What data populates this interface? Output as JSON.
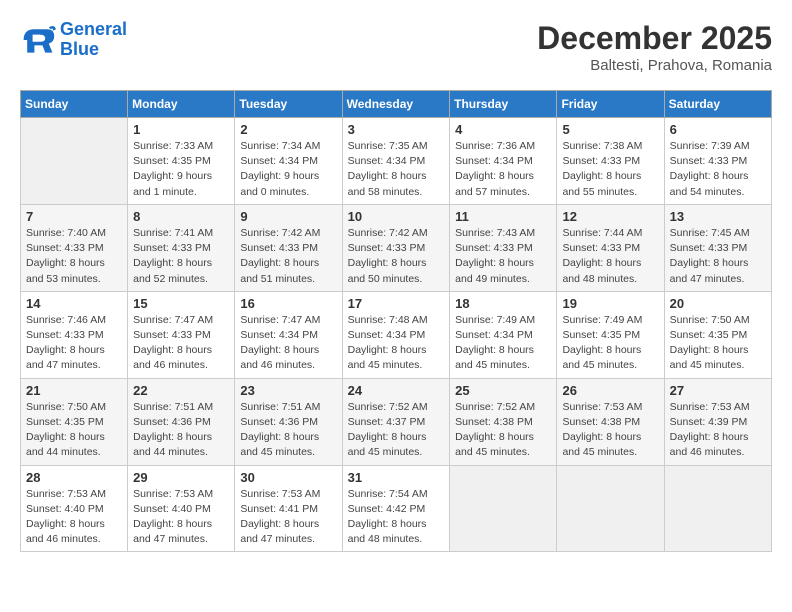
{
  "header": {
    "logo_general": "General",
    "logo_blue": "Blue",
    "month_year": "December 2025",
    "location": "Baltesti, Prahova, Romania"
  },
  "days_of_week": [
    "Sunday",
    "Monday",
    "Tuesday",
    "Wednesday",
    "Thursday",
    "Friday",
    "Saturday"
  ],
  "weeks": [
    [
      {
        "day": "",
        "empty": true
      },
      {
        "day": "1",
        "sunrise": "7:33 AM",
        "sunset": "4:35 PM",
        "daylight": "9 hours and 1 minute."
      },
      {
        "day": "2",
        "sunrise": "7:34 AM",
        "sunset": "4:34 PM",
        "daylight": "9 hours and 0 minutes."
      },
      {
        "day": "3",
        "sunrise": "7:35 AM",
        "sunset": "4:34 PM",
        "daylight": "8 hours and 58 minutes."
      },
      {
        "day": "4",
        "sunrise": "7:36 AM",
        "sunset": "4:34 PM",
        "daylight": "8 hours and 57 minutes."
      },
      {
        "day": "5",
        "sunrise": "7:38 AM",
        "sunset": "4:33 PM",
        "daylight": "8 hours and 55 minutes."
      },
      {
        "day": "6",
        "sunrise": "7:39 AM",
        "sunset": "4:33 PM",
        "daylight": "8 hours and 54 minutes."
      }
    ],
    [
      {
        "day": "7",
        "sunrise": "7:40 AM",
        "sunset": "4:33 PM",
        "daylight": "8 hours and 53 minutes."
      },
      {
        "day": "8",
        "sunrise": "7:41 AM",
        "sunset": "4:33 PM",
        "daylight": "8 hours and 52 minutes."
      },
      {
        "day": "9",
        "sunrise": "7:42 AM",
        "sunset": "4:33 PM",
        "daylight": "8 hours and 51 minutes."
      },
      {
        "day": "10",
        "sunrise": "7:42 AM",
        "sunset": "4:33 PM",
        "daylight": "8 hours and 50 minutes."
      },
      {
        "day": "11",
        "sunrise": "7:43 AM",
        "sunset": "4:33 PM",
        "daylight": "8 hours and 49 minutes."
      },
      {
        "day": "12",
        "sunrise": "7:44 AM",
        "sunset": "4:33 PM",
        "daylight": "8 hours and 48 minutes."
      },
      {
        "day": "13",
        "sunrise": "7:45 AM",
        "sunset": "4:33 PM",
        "daylight": "8 hours and 47 minutes."
      }
    ],
    [
      {
        "day": "14",
        "sunrise": "7:46 AM",
        "sunset": "4:33 PM",
        "daylight": "8 hours and 47 minutes."
      },
      {
        "day": "15",
        "sunrise": "7:47 AM",
        "sunset": "4:33 PM",
        "daylight": "8 hours and 46 minutes."
      },
      {
        "day": "16",
        "sunrise": "7:47 AM",
        "sunset": "4:34 PM",
        "daylight": "8 hours and 46 minutes."
      },
      {
        "day": "17",
        "sunrise": "7:48 AM",
        "sunset": "4:34 PM",
        "daylight": "8 hours and 45 minutes."
      },
      {
        "day": "18",
        "sunrise": "7:49 AM",
        "sunset": "4:34 PM",
        "daylight": "8 hours and 45 minutes."
      },
      {
        "day": "19",
        "sunrise": "7:49 AM",
        "sunset": "4:35 PM",
        "daylight": "8 hours and 45 minutes."
      },
      {
        "day": "20",
        "sunrise": "7:50 AM",
        "sunset": "4:35 PM",
        "daylight": "8 hours and 45 minutes."
      }
    ],
    [
      {
        "day": "21",
        "sunrise": "7:50 AM",
        "sunset": "4:35 PM",
        "daylight": "8 hours and 44 minutes."
      },
      {
        "day": "22",
        "sunrise": "7:51 AM",
        "sunset": "4:36 PM",
        "daylight": "8 hours and 44 minutes."
      },
      {
        "day": "23",
        "sunrise": "7:51 AM",
        "sunset": "4:36 PM",
        "daylight": "8 hours and 45 minutes."
      },
      {
        "day": "24",
        "sunrise": "7:52 AM",
        "sunset": "4:37 PM",
        "daylight": "8 hours and 45 minutes."
      },
      {
        "day": "25",
        "sunrise": "7:52 AM",
        "sunset": "4:38 PM",
        "daylight": "8 hours and 45 minutes."
      },
      {
        "day": "26",
        "sunrise": "7:53 AM",
        "sunset": "4:38 PM",
        "daylight": "8 hours and 45 minutes."
      },
      {
        "day": "27",
        "sunrise": "7:53 AM",
        "sunset": "4:39 PM",
        "daylight": "8 hours and 46 minutes."
      }
    ],
    [
      {
        "day": "28",
        "sunrise": "7:53 AM",
        "sunset": "4:40 PM",
        "daylight": "8 hours and 46 minutes."
      },
      {
        "day": "29",
        "sunrise": "7:53 AM",
        "sunset": "4:40 PM",
        "daylight": "8 hours and 47 minutes."
      },
      {
        "day": "30",
        "sunrise": "7:53 AM",
        "sunset": "4:41 PM",
        "daylight": "8 hours and 47 minutes."
      },
      {
        "day": "31",
        "sunrise": "7:54 AM",
        "sunset": "4:42 PM",
        "daylight": "8 hours and 48 minutes."
      },
      {
        "day": "",
        "empty": true
      },
      {
        "day": "",
        "empty": true
      },
      {
        "day": "",
        "empty": true
      }
    ]
  ]
}
